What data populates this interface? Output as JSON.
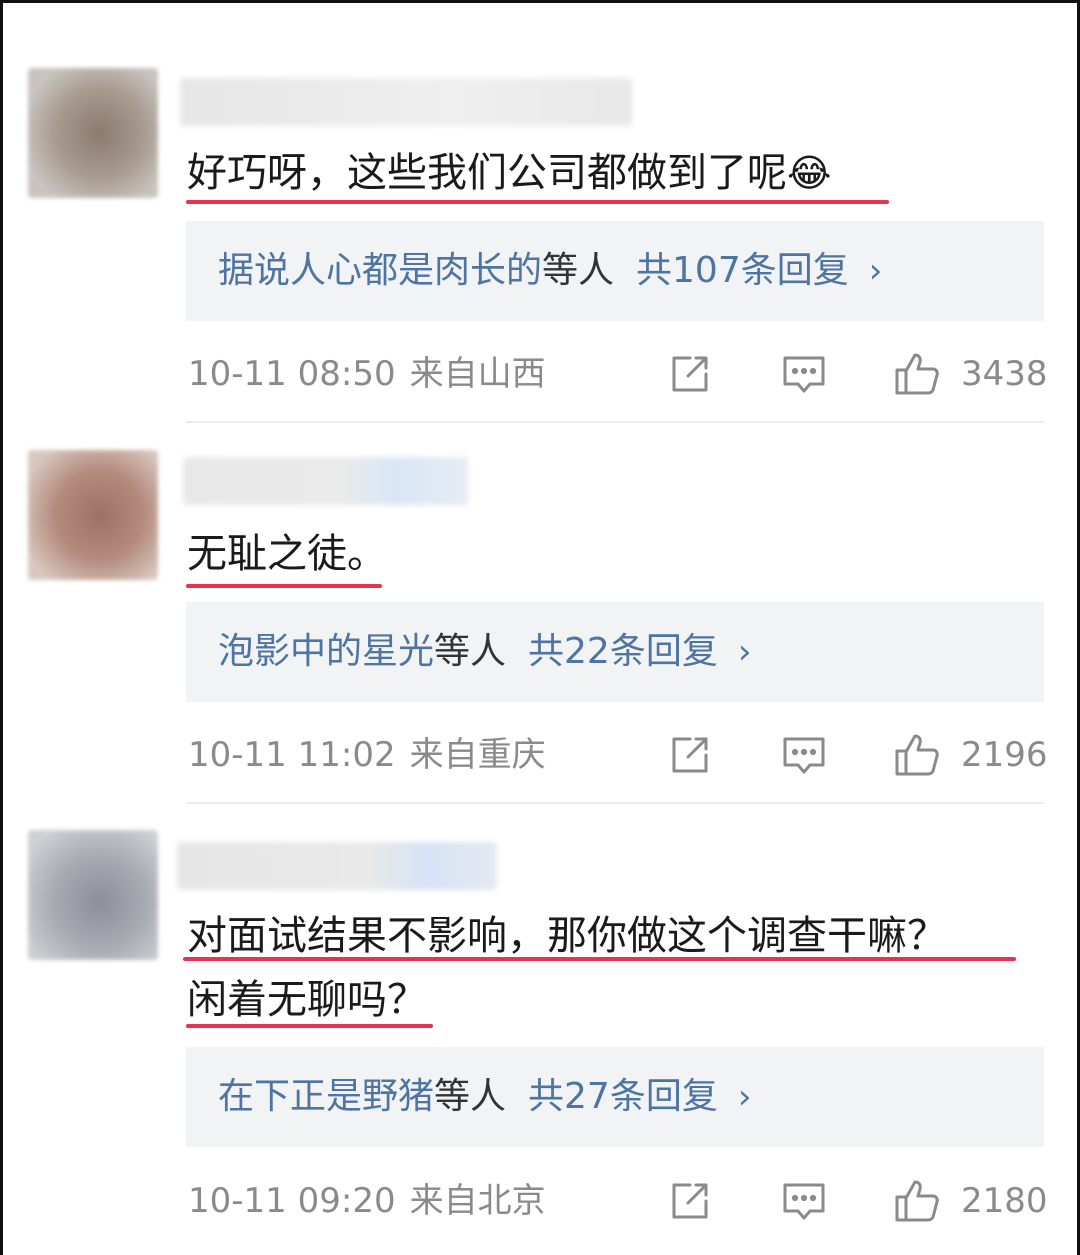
{
  "comments": [
    {
      "text_lines": [
        "好巧呀，这些我们公司都做到了呢"
      ],
      "emoji": "😂",
      "reply_names": "据说人心都是肉长的",
      "reply_suffix": "等人",
      "reply_count": "共107条回复",
      "reply_chevron": "›",
      "date_time": "10-11 08:50",
      "location": "来自山西",
      "likes": "3438"
    },
    {
      "text_lines": [
        "无耻之徒。"
      ],
      "reply_names": "泡影中的星光",
      "reply_suffix": "等人",
      "reply_count": "共22条回复",
      "reply_chevron": "›",
      "date_time": "10-11 11:02",
      "location": "来自重庆",
      "likes": "2196"
    },
    {
      "text_lines": [
        "对面试结果不影响，那你做这个调查干嘛？",
        "闲着无聊吗？"
      ],
      "reply_names": "在下正是野猪",
      "reply_suffix": "等人",
      "reply_count": "共27条回复",
      "reply_chevron": "›",
      "date_time": "10-11 09:20",
      "location": "来自北京",
      "likes": "2180"
    }
  ],
  "icons": {
    "share": "share-edit-icon",
    "comment": "comment-bubble-icon",
    "like": "thumbs-up-icon"
  },
  "colors": {
    "underline": "#e8334f",
    "reply_link": "#4e74a3",
    "meta": "#8a8a8a",
    "reply_bg": "#f2f3f5"
  }
}
